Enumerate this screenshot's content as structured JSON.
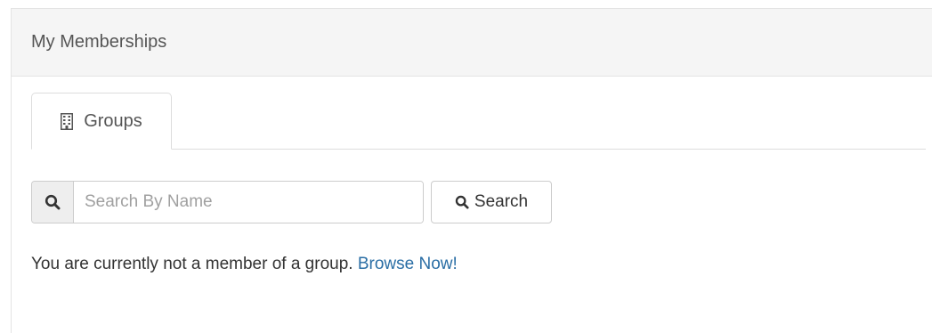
{
  "panel": {
    "title": "My Memberships"
  },
  "tabs": [
    {
      "label": "Groups",
      "icon": "building-icon",
      "active": true
    }
  ],
  "search": {
    "placeholder": "Search By Name",
    "value": "",
    "addon_icon": "search-icon",
    "button_label": "Search",
    "button_icon": "search-icon"
  },
  "message": {
    "text": "You are currently not a member of a group.",
    "link_label": "Browse Now!"
  },
  "colors": {
    "heading_bg": "#f5f5f5",
    "link": "#2a6ea5",
    "border": "#dddddd"
  }
}
